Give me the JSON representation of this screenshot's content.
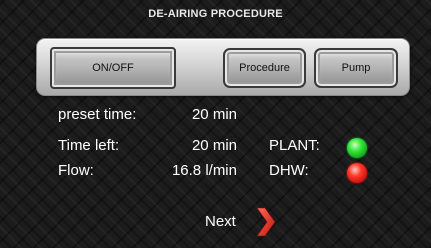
{
  "header": {
    "title": "DE-AIRING PROCEDURE"
  },
  "controls": {
    "onoff_label": "ON/OFF",
    "procedure_label": "Procedure",
    "pump_label": "Pump"
  },
  "status": {
    "preset_time_label": "preset time:",
    "preset_time_value": "20 min",
    "time_left_label": "Time left:",
    "time_left_value": "20 min",
    "flow_label": "Flow:",
    "flow_value": "16.8 l/min",
    "plant_label": "PLANT:",
    "plant_state_color": "#2ad52f",
    "dhw_label": "DHW:",
    "dhw_state_color": "#e81818"
  },
  "navigation": {
    "next_label": "Next",
    "next_icon": "chevron-right-icon"
  }
}
